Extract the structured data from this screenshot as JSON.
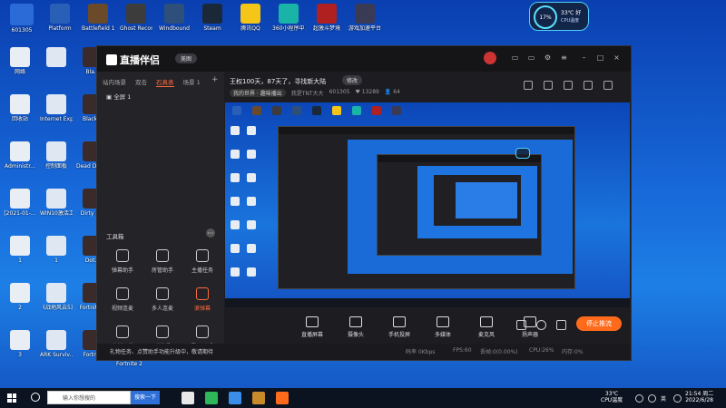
{
  "desktop": {
    "top_icons": [
      {
        "label": "Platform",
        "color": "#2a5fb8"
      },
      {
        "label": "Battlefield 1™",
        "color": "#6b4a2a"
      },
      {
        "label": "Ghost Recon®...",
        "color": "#3c3c3c"
      },
      {
        "label": "Windbound",
        "color": "#2d4f7a"
      },
      {
        "label": "Steam",
        "color": "#1b2838"
      },
      {
        "label": "腾讯QQ",
        "color": "#f5c518"
      },
      {
        "label": "360小程序中心",
        "color": "#1ab3a8"
      },
      {
        "label": "超激斗梦境",
        "color": "#b02020"
      },
      {
        "label": "游戏加速平台",
        "color": "#3a3a55"
      }
    ],
    "logo_line1": "斗鱼",
    "logo_line2": "直播",
    "room_number": "601305",
    "left_icons": [
      {
        "label": "网络"
      },
      {
        "label": "回收站"
      },
      {
        "label": "Administr..."
      },
      {
        "label": "[2021-01-..."
      },
      {
        "label": "1"
      },
      {
        "label": "2"
      },
      {
        "label": "3"
      }
    ],
    "second_icons": [
      {
        "label": ""
      },
      {
        "label": "Internet Explorer"
      },
      {
        "label": "控制面板"
      },
      {
        "label": "WIN10激活工具"
      },
      {
        "label": "1"
      },
      {
        "label": "《战地风云5》"
      },
      {
        "label": "ARK Surviv..."
      }
    ],
    "third_icons": [
      {
        "label": "Bla..."
      },
      {
        "label": "Black..."
      },
      {
        "label": "Dead Dayli..."
      },
      {
        "label": "Dirty B..."
      },
      {
        "label": "Dot..."
      },
      {
        "label": "Fortnite..."
      },
      {
        "label": "Fortn..."
      }
    ],
    "fortnite_label": "Fortnite 2"
  },
  "cpu_widget": {
    "percent": "17%",
    "temp": "33℃ 好",
    "label": "CPU温度"
  },
  "app": {
    "name": "直播伴侣",
    "version_badge": "美图",
    "scene_tabs": [
      "站内场景",
      "双击",
      "石真表",
      "场景 1"
    ],
    "active_tab_index": 2,
    "scene_item": "全屏 1",
    "room_title": "王权100天，87天了，寻找新大陆",
    "edit_label": "修改",
    "info": {
      "channel": "我的世界 · 趣味播出",
      "streamer": "我是TNT大大",
      "room_id": "601305",
      "fans": "13289",
      "viewers": "64"
    },
    "tools_title": "工具箱",
    "tools": [
      {
        "label": "弹幕助手",
        "hot": false
      },
      {
        "label": "房管助手",
        "hot": false
      },
      {
        "label": "主播任务",
        "hot": false
      },
      {
        "label": "视频连麦",
        "hot": false
      },
      {
        "label": "多人连麦",
        "hot": false
      },
      {
        "label": "滚弹幕",
        "hot": true
      },
      {
        "label": "素材下载",
        "hot": false
      },
      {
        "label": "弹幕秀",
        "hot": false
      },
      {
        "label": "歌词助手",
        "hot": false
      }
    ],
    "bottom_tools": [
      {
        "label": "直播屏幕"
      },
      {
        "label": "摄像头"
      },
      {
        "label": "手机投屏"
      },
      {
        "label": "多媒体"
      },
      {
        "label": "麦克风"
      },
      {
        "label": "扬声器"
      }
    ],
    "stop_label": "停止推流",
    "status_msg": "礼物任务、点赞助手功能升级中，敬请期待",
    "status": {
      "bitrate": "码率 0Kbps",
      "fps": "FPS:60",
      "drop": "丢帧:0(0.00%)",
      "cpu": "CPU:26%",
      "mem": "内存:0%"
    }
  },
  "taskbar": {
    "search_placeholder": "输入你想搜的",
    "search_button": "搜索一下",
    "apps": [
      {
        "color": "#e8e8e8"
      },
      {
        "color": "#2fb85a"
      },
      {
        "color": "#3a8ee6"
      },
      {
        "color": "#c98a2a"
      },
      {
        "color": "#ff6b1a"
      }
    ],
    "temp": "33℃",
    "temp_label": "CPU温度",
    "lang": "英",
    "time": "21:54 周二",
    "date": "2022/6/28"
  }
}
